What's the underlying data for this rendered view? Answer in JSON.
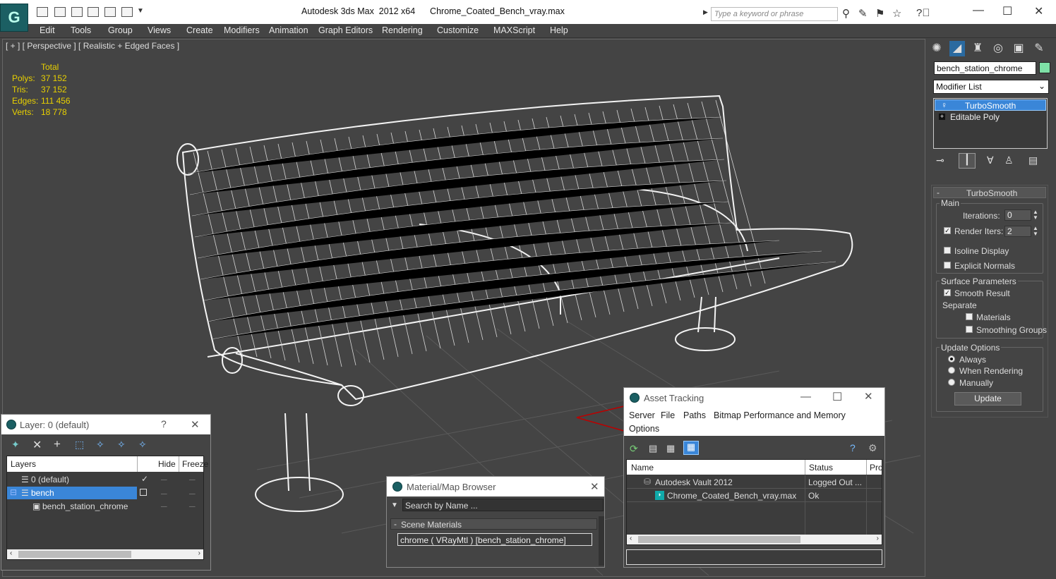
{
  "app": {
    "logo": "G",
    "title": "Autodesk 3ds Max  2012 x64      Chrome_Coated_Bench_vray.max",
    "search_placeholder": "Type a keyword or phrase",
    "window_buttons": {
      "minimize": "—",
      "maximize": "☐",
      "close": "✕"
    }
  },
  "menu": [
    "Edit",
    "Tools",
    "Group",
    "Views",
    "Create",
    "Modifiers",
    "Animation",
    "Graph Editors",
    "Rendering",
    "Customize",
    "MAXScript",
    "Help"
  ],
  "viewport": {
    "label": "[ + ] [ Perspective ] [ Realistic + Edged Faces ]",
    "stats_header": "Total",
    "stats": [
      {
        "label": "Polys:",
        "value": "37 152"
      },
      {
        "label": "Tris:",
        "value": "37 152"
      },
      {
        "label": "Edges:",
        "value": "111 456"
      },
      {
        "label": "Verts:",
        "value": "18 778"
      }
    ]
  },
  "command_panel": {
    "object_name": "bench_station_chrome",
    "object_color": "#7ee0a6",
    "modifier_list_label": "Modifier List",
    "stack": [
      {
        "label": "TurboSmooth",
        "selected": true
      },
      {
        "label": "Editable Poly",
        "selected": false
      }
    ],
    "rollout_title": "TurboSmooth",
    "main": {
      "title": "Main",
      "iterations_label": "Iterations:",
      "iterations_value": "0",
      "render_iters_label": "Render Iters:",
      "render_iters_value": "2",
      "render_iters_checked": true,
      "isoline_label": "Isoline Display",
      "explicit_normals_label": "Explicit Normals"
    },
    "surface": {
      "title": "Surface Parameters",
      "smooth_result_label": "Smooth Result",
      "separate_label": "Separate",
      "materials_label": "Materials",
      "smoothing_groups_label": "Smoothing Groups"
    },
    "update": {
      "title": "Update Options",
      "options": [
        "Always",
        "When Rendering",
        "Manually"
      ],
      "selected": "Always",
      "button": "Update"
    }
  },
  "layer_window": {
    "title": "Layer: 0 (default)",
    "help": "?",
    "close": "✕",
    "columns": [
      "Layers",
      "Hide",
      "Freeze"
    ],
    "rows": [
      {
        "label": "0 (default)",
        "indent": 1,
        "selected": false,
        "check": "✓"
      },
      {
        "label": "bench",
        "indent": 1,
        "selected": true,
        "check": ""
      },
      {
        "label": "bench_station_chrome",
        "indent": 2,
        "selected": false,
        "check": ""
      }
    ]
  },
  "material_browser": {
    "title": "Material/Map Browser",
    "close": "✕",
    "search_placeholder": "Search by Name ...",
    "section": "Scene Materials",
    "item": "chrome  ( VRayMtl )  [bench_station_chrome]"
  },
  "asset_tracking": {
    "title": "Asset Tracking",
    "menu": [
      "Server",
      "File",
      "Paths",
      "Bitmap Performance and Memory",
      "Options"
    ],
    "columns": [
      "Name",
      "Status",
      "Pro"
    ],
    "rows": [
      {
        "name": "Autodesk Vault 2012",
        "status": "Logged Out ..."
      },
      {
        "name": "Chrome_Coated_Bench_vray.max",
        "status": "Ok"
      }
    ]
  }
}
